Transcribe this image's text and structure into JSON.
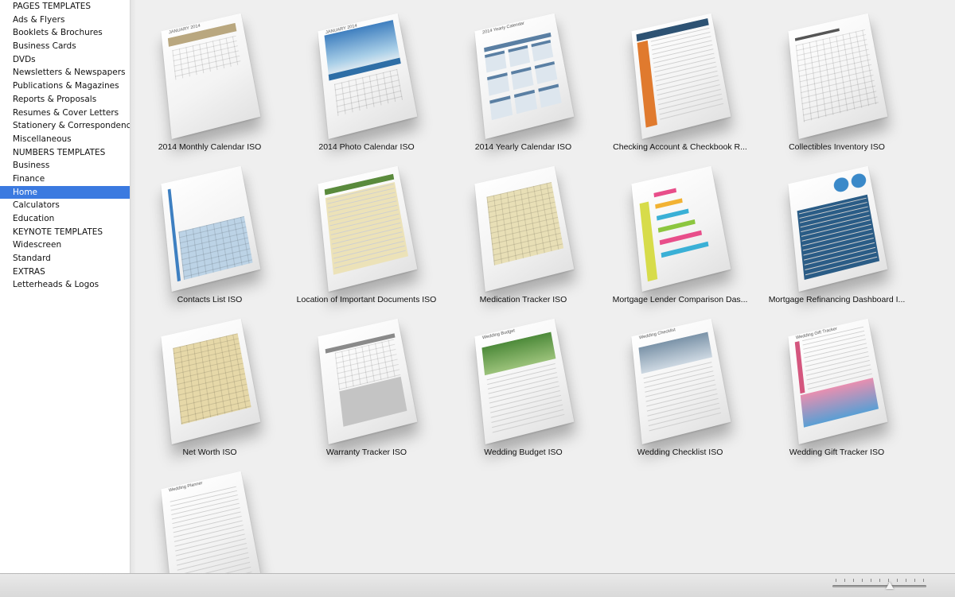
{
  "sidebar": {
    "items": [
      {
        "label": "PAGES TEMPLATES"
      },
      {
        "label": "Ads & Flyers"
      },
      {
        "label": "Booklets & Brochures"
      },
      {
        "label": "Business Cards"
      },
      {
        "label": "DVDs"
      },
      {
        "label": "Newsletters & Newspapers"
      },
      {
        "label": "Publications & Magazines"
      },
      {
        "label": "Reports & Proposals"
      },
      {
        "label": "Resumes & Cover Letters"
      },
      {
        "label": "Stationery & Correspondence"
      },
      {
        "label": "Miscellaneous"
      },
      {
        "label": "NUMBERS TEMPLATES"
      },
      {
        "label": "Business"
      },
      {
        "label": "Finance"
      },
      {
        "label": "Home",
        "selected": true
      },
      {
        "label": "Calculators"
      },
      {
        "label": "Education"
      },
      {
        "label": "KEYNOTE TEMPLATES"
      },
      {
        "label": "Widescreen"
      },
      {
        "label": "Standard"
      },
      {
        "label": "EXTRAS"
      },
      {
        "label": "Letterheads & Logos"
      }
    ]
  },
  "templates": [
    {
      "label": "2014 Monthly Calendar ISO",
      "style": "monthly",
      "accent": "#b9a77f",
      "page_title": "JANUARY 2014"
    },
    {
      "label": "2014 Photo Calendar ISO",
      "style": "photo",
      "accent": "#2e6ea6",
      "page_title": "JANUARY 2014"
    },
    {
      "label": "2014 Yearly Calendar ISO",
      "style": "yearly",
      "accent": "#5a7fa3",
      "page_title": "2014 Yearly Calendar"
    },
    {
      "label": "Checking Account & Checkbook R...",
      "style": "checking",
      "accent": "#e07a2e"
    },
    {
      "label": "Collectibles Inventory ISO",
      "style": "inventory",
      "accent": "#555555"
    },
    {
      "label": "Contacts List ISO",
      "style": "contacts",
      "accent": "#3d7fc1"
    },
    {
      "label": "Location of Important Documents ISO",
      "style": "location",
      "accent": "#5a8a3c"
    },
    {
      "label": "Medication Tracker ISO",
      "style": "medication",
      "accent": "#e8dfb6"
    },
    {
      "label": "Mortgage Lender Comparison Das...",
      "style": "mortgage",
      "accent": "#d7dc4a"
    },
    {
      "label": "Mortgage Refinancing Dashboard I...",
      "style": "refinance",
      "accent": "#2a5c86"
    },
    {
      "label": "Net Worth ISO",
      "style": "networth",
      "accent": "#e6d8a8"
    },
    {
      "label": "Warranty Tracker ISO",
      "style": "warranty",
      "accent": "#8a8a8a"
    },
    {
      "label": "Wedding Budget ISO",
      "style": "wbudget",
      "accent": "#5e9a3f",
      "page_title": "Wedding Budget"
    },
    {
      "label": "Wedding Checklist ISO",
      "style": "wchecklist",
      "accent": "#6a8fb3",
      "page_title": "Wedding Checklist"
    },
    {
      "label": "Wedding Gift Tracker ISO",
      "style": "wgift",
      "accent": "#d4567e",
      "page_title": "Wedding Gift Tracker"
    },
    {
      "label": "",
      "style": "wplanner",
      "accent": "#999999",
      "page_title": "Wedding Planner"
    }
  ],
  "zoom": {
    "value": 0.62,
    "ticks": 11
  }
}
